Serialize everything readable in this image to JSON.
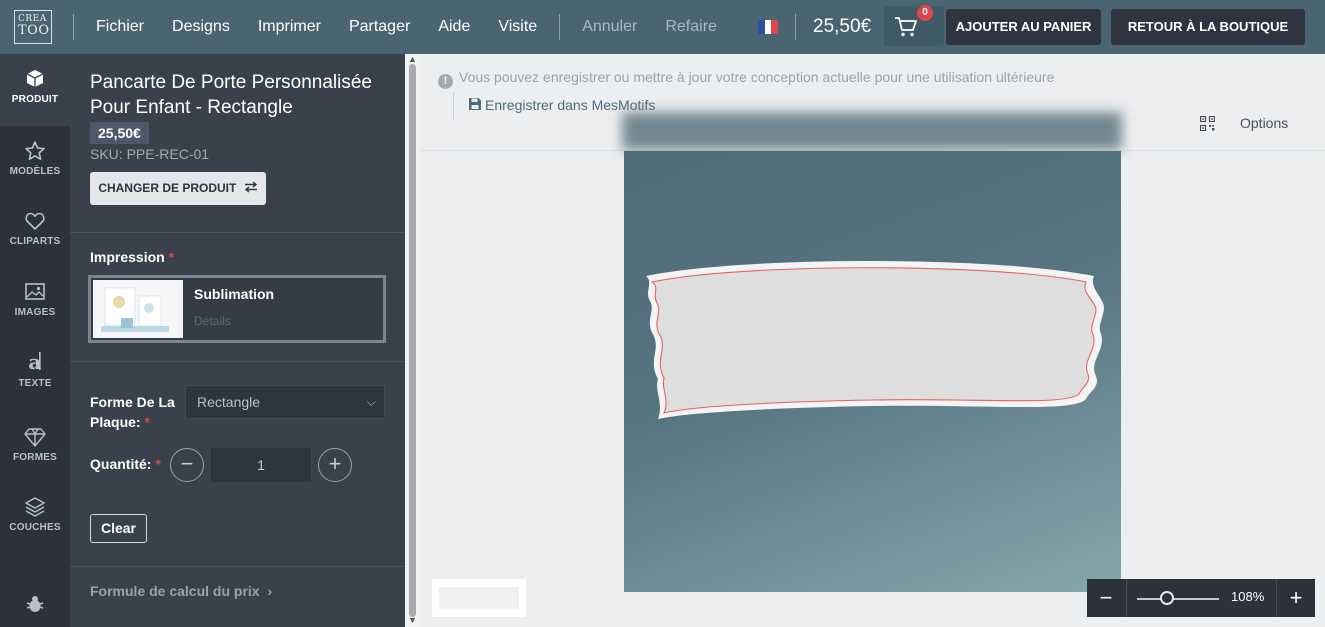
{
  "header": {
    "logo_top": "CREA",
    "logo_bottom": "TOO",
    "menu": [
      "Fichier",
      "Designs",
      "Imprimer",
      "Partager",
      "Aide",
      "Visite"
    ],
    "undo": "Annuler",
    "redo": "Refaire",
    "price": "25,50€",
    "cart_count": "0",
    "add_to_cart": "AJOUTER AU PANIER",
    "back_to_shop": "RETOUR À LA BOUTIQUE"
  },
  "rail": {
    "items": [
      "PRODUIT",
      "MODÈLES",
      "CLIPARTS",
      "IMAGES",
      "TEXTE",
      "FORMES",
      "COUCHES"
    ]
  },
  "panel": {
    "title": "Pancarte De Porte Personnalisée Pour Enfant - Rectangle",
    "price": "25,50€",
    "sku": "SKU: PPE-REC-01",
    "change_product": "CHANGER DE PRODUIT",
    "impression_label": "Impression",
    "required_mark": "*",
    "impression_option": "Sublimation",
    "impression_details": "Détails",
    "shape_label": "Forme De La Plaque:",
    "shape_value": "Rectangle",
    "quantity_label": "Quantité:",
    "quantity_value": "1",
    "clear": "Clear",
    "formula": "Formule de calcul du prix"
  },
  "canvas": {
    "info": "Vous pouvez enregistrer ou mettre à jour votre conception actuelle pour une utilisation ultérieure",
    "save": "Enregistrer dans MesMotifs",
    "options": "Options",
    "zoom": "108%"
  },
  "colors": {
    "topbar": "#4a6472",
    "rail": "#2c313c",
    "panel": "#3a404c",
    "accent_red": "#e0454b"
  }
}
